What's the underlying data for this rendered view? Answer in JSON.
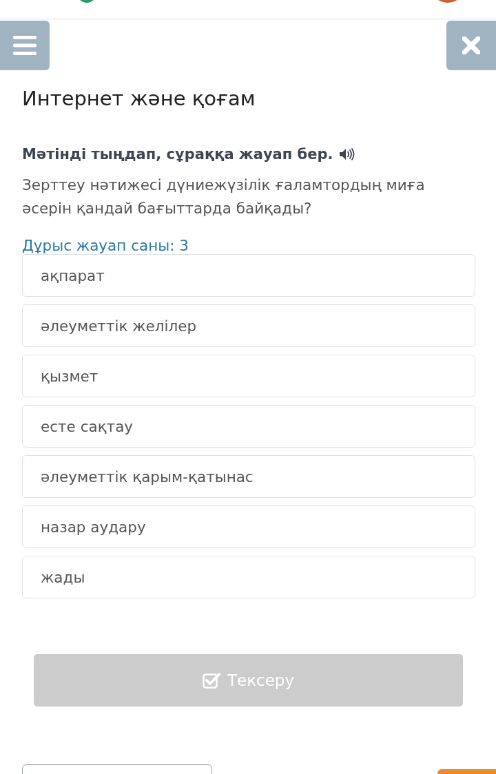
{
  "lesson_title": "Интернет және қоғам",
  "instruction": "Мәтінді тыңдап, сұраққа жауап бер.",
  "question": "Зерттеу нәтижесі дүниежүзілік ғаламтордың миға әсерін қандай бағыттарда байқады?",
  "answer_count": "Дұрыс жауап саны: 3",
  "options": [
    {
      "label": "ақпарат",
      "selected": false
    },
    {
      "label": "әлеуметтік желілер",
      "selected": false
    },
    {
      "label": "қызмет",
      "selected": false
    },
    {
      "label": "есте сақтау",
      "selected": false
    },
    {
      "label": "әлеуметтік қарым-қатынас",
      "selected": false
    },
    {
      "label": "назар аудару",
      "selected": false
    },
    {
      "label": "жады",
      "selected": false
    }
  ],
  "check_button": {
    "label": "Тексеру",
    "disabled": true
  }
}
